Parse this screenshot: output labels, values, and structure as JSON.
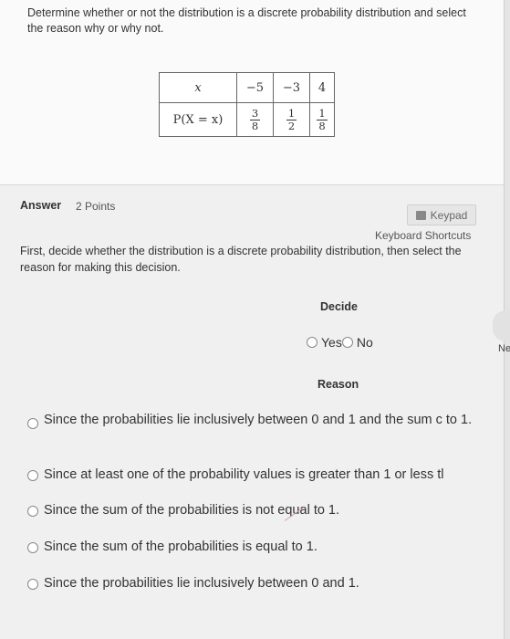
{
  "question": {
    "text": "Determine whether or not the distribution is a discrete probability distribution and select the reason why or why not.",
    "table": {
      "x_header": "x",
      "p_header": "P(X = x)",
      "x_values": [
        "−5",
        "−3",
        "4"
      ],
      "probabilities": [
        {
          "num": "3",
          "den": "8"
        },
        {
          "num": "1",
          "den": "2"
        },
        {
          "num": "1",
          "den": "8"
        }
      ]
    }
  },
  "answer": {
    "label": "Answer",
    "points": "2 Points",
    "keypad_label": "Keypad",
    "keyboard_shortcuts": "Keyboard Shortcuts",
    "instruction": "First, decide whether the distribution is a discrete probability distribution, then select the reason for making this decision.",
    "decide_label": "Decide",
    "decide_options": [
      "Yes",
      "No"
    ],
    "reason_label": "Reason",
    "reasons": [
      "Since the probabilities lie inclusively between 0 and 1 and the sum c to 1.",
      "Since at least one of the probability values is greater than 1 or less tl",
      "Since the sum of the probabilities is not equal to 1.",
      "Since the sum of the probabilities is equal to 1.",
      "Since the probabilities lie inclusively between 0 and 1."
    ]
  },
  "side": {
    "next_label": "Ne"
  },
  "colors": {
    "question_bg": "#fafafa",
    "answer_bg": "#f0f0f0",
    "text": "#333333"
  }
}
